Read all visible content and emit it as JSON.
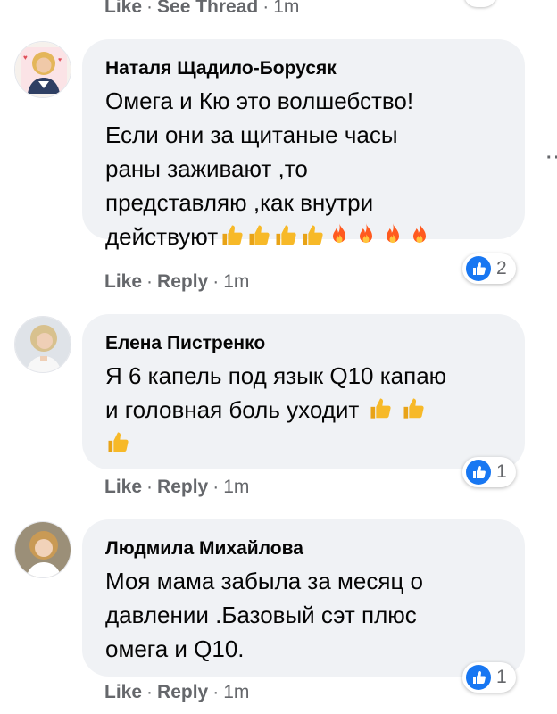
{
  "top": {
    "like": "Like",
    "sep": "·",
    "see_thread": "See Thread",
    "time": "1m"
  },
  "comments": [
    {
      "author": "Наталя Щадило-Борусяк",
      "lines": [
        "Омега и Кю это волшебство!",
        "Если они за щитаные часы",
        "раны заживают ,то",
        "представляю ,как внутри",
        "действуют"
      ],
      "emojis": [
        "thumbs-up",
        "thumbs-up",
        "thumbs-up",
        "thumbs-up",
        "fire",
        "fire",
        "fire",
        "fire"
      ],
      "reaction_count": "2",
      "like": "Like",
      "reply": "Reply",
      "sep": "·",
      "time": "1m"
    },
    {
      "author": "Елена Пистренко",
      "lines": [
        "Я 6 капель под язык Q10 капаю",
        "и головная боль уходит"
      ],
      "emojis": [
        "thumbs-up",
        "thumbs-up",
        "thumbs-up"
      ],
      "reaction_count": "1",
      "like": "Like",
      "reply": "Reply",
      "sep": "·",
      "time": "1m"
    },
    {
      "author": "Людмила Михайлова",
      "lines": [
        "Моя мама забыла за месяц о",
        "давлении .Базовый сэт плюс",
        "омега и Q10."
      ],
      "reaction_count": "1",
      "like": "Like",
      "reply": "Reply",
      "sep": "·",
      "time": "1m"
    }
  ],
  "more_options": "··",
  "colors": {
    "bubble": "#f0f2f5",
    "meta": "#65676b",
    "like_blue": "#1877f2",
    "thumb": "#f7b928",
    "fire": "#ff5a1f"
  },
  "icons": [
    "like-reaction-icon",
    "thumbs-up-emoji-icon",
    "fire-emoji-icon",
    "more-options-icon"
  ]
}
